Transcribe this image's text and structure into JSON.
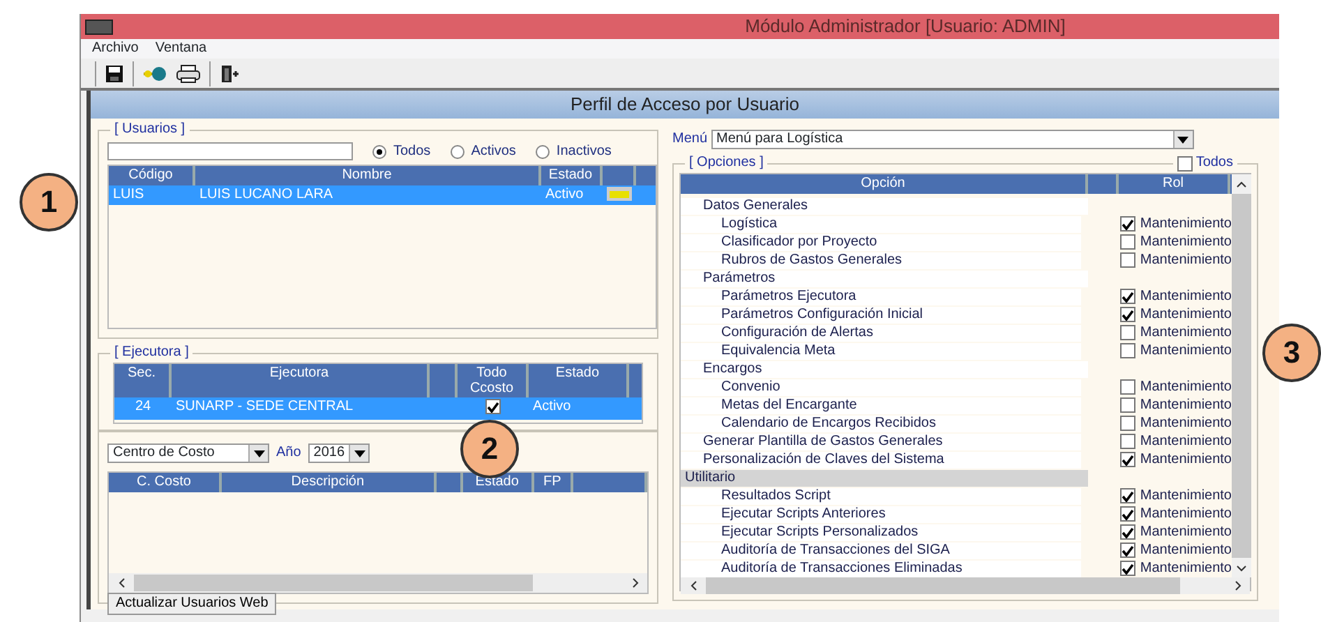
{
  "window": {
    "title": "Módulo Administrador [Usuario: ADMIN]"
  },
  "menu": [
    "Archivo",
    "Ventana"
  ],
  "form_title": "Perfil de Acceso por Usuario",
  "users": {
    "legend": "[ Usuarios ]",
    "filters": [
      {
        "label": "Todos",
        "selected": true
      },
      {
        "label": "Activos",
        "selected": false
      },
      {
        "label": "Inactivos",
        "selected": false
      }
    ],
    "columns": [
      "Código",
      "Nombre",
      "Estado"
    ],
    "rows": [
      {
        "code": "LUIS",
        "name": "LUIS LUCANO LARA",
        "status": "Activo",
        "selected": true
      }
    ]
  },
  "executor": {
    "legend": "[ Ejecutora ]",
    "columns": [
      "Sec.",
      "Ejecutora",
      "Todo Ccosto",
      "Estado"
    ],
    "rows": [
      {
        "sec": "24",
        "name": "SUNARP - SEDE CENTRAL",
        "all_cost": true,
        "status": "Activo",
        "selected": true
      }
    ]
  },
  "cost_centers": {
    "filter": "Centro de Costo",
    "year_label": "Año",
    "year": "2016",
    "columns": [
      "C. Costo",
      "Descripción",
      "Estado",
      "FP"
    ]
  },
  "update_button": "Actualizar Usuarios Web",
  "menu_select": {
    "label": "Menú",
    "value": "Menú para Logística"
  },
  "options": {
    "legend": "[ Opciones ]",
    "all": {
      "label": "Todos",
      "checked": false
    },
    "columns": [
      "Opción",
      "Rol"
    ],
    "rows": [
      {
        "kind": "group",
        "label": "Datos Generales",
        "children": [
          {
            "kind": "item",
            "label": "Logística",
            "checked": true,
            "role": "Mantenimiento"
          },
          {
            "kind": "item",
            "label": "Clasificador por Proyecto",
            "checked": false,
            "role": "Mantenimiento"
          },
          {
            "kind": "item",
            "label": "Rubros de Gastos Generales",
            "checked": false,
            "role": "Mantenimiento"
          }
        ]
      },
      {
        "kind": "group",
        "label": "Parámetros",
        "children": [
          {
            "kind": "item",
            "label": "Parámetros Ejecutora",
            "checked": true,
            "role": "Mantenimiento"
          },
          {
            "kind": "item",
            "label": "Parámetros Configuración Inicial",
            "checked": true,
            "role": "Mantenimiento"
          },
          {
            "kind": "item",
            "label": "Configuración de Alertas",
            "checked": false,
            "role": "Mantenimiento"
          },
          {
            "kind": "item",
            "label": "Equivalencia Meta",
            "checked": false,
            "role": "Mantenimiento"
          }
        ]
      },
      {
        "kind": "group",
        "label": "Encargos",
        "children": [
          {
            "kind": "item",
            "label": "Convenio",
            "checked": false,
            "role": "Mantenimiento"
          },
          {
            "kind": "item",
            "label": "Metas del Encargante",
            "checked": false,
            "role": "Mantenimiento"
          },
          {
            "kind": "item",
            "label": "Calendario de Encargos Recibidos",
            "checked": false,
            "role": "Mantenimiento"
          }
        ]
      },
      {
        "kind": "item",
        "label": "Generar Plantilla de Gastos Generales",
        "checked": false,
        "role": "Mantenimiento"
      },
      {
        "kind": "item",
        "label": "Personalización de Claves del Sistema",
        "checked": true,
        "role": "Mantenimiento"
      },
      {
        "kind": "module",
        "label": "Utilitario",
        "children": [
          {
            "kind": "item",
            "label": "Resultados Script",
            "checked": true,
            "role": "Mantenimiento"
          },
          {
            "kind": "item",
            "label": "Ejecutar Scripts Anteriores",
            "checked": true,
            "role": "Mantenimiento"
          },
          {
            "kind": "item",
            "label": "Ejecutar Scripts Personalizados",
            "checked": true,
            "role": "Mantenimiento"
          },
          {
            "kind": "item",
            "label": "Auditoría de Transacciones del SIGA",
            "checked": true,
            "role": "Mantenimiento"
          },
          {
            "kind": "item",
            "label": "Auditoría de Transacciones Eliminadas",
            "checked": true,
            "role": "Mantenimiento"
          }
        ]
      }
    ]
  },
  "callouts": [
    "1",
    "2",
    "3"
  ]
}
